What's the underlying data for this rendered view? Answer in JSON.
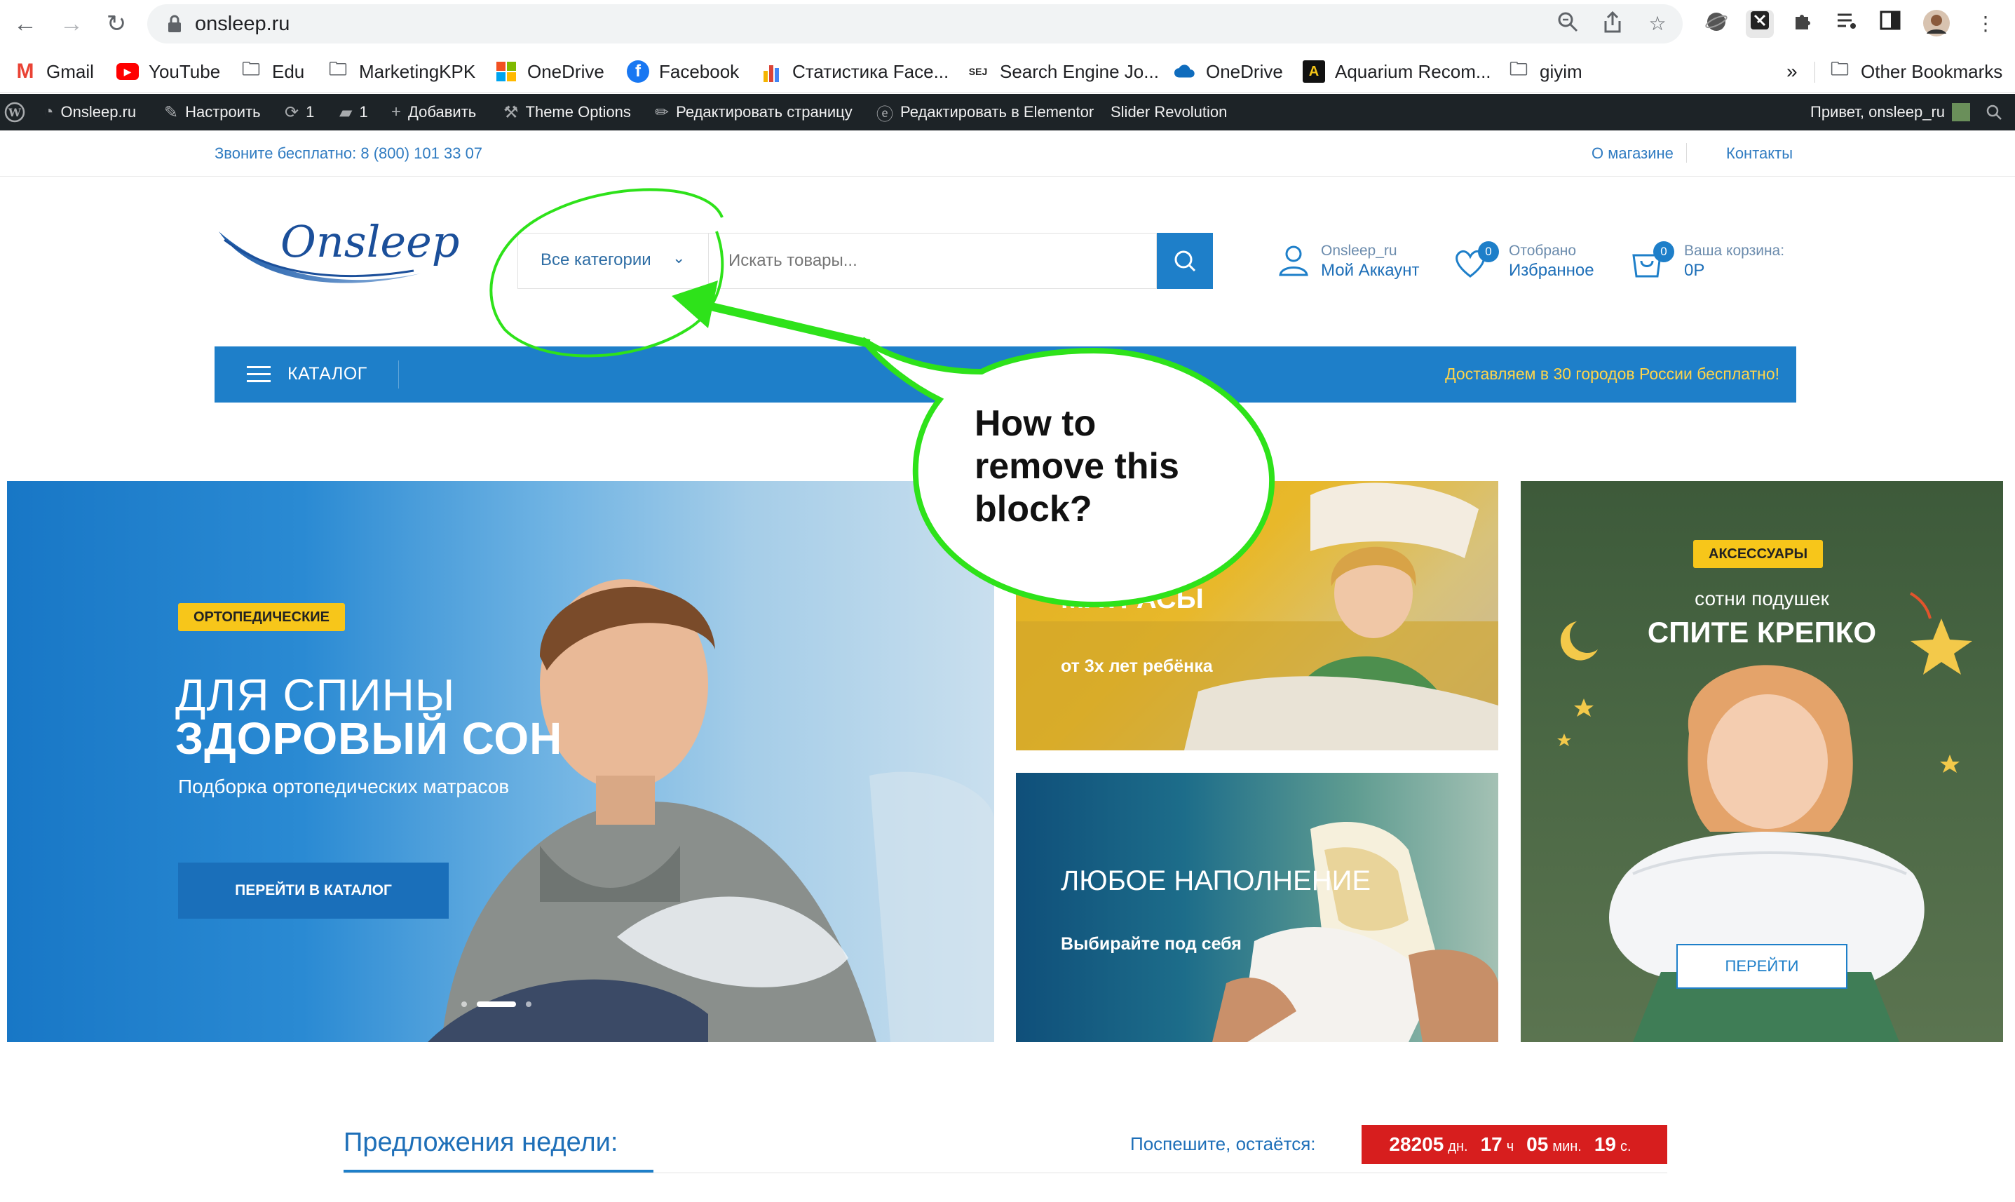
{
  "browser": {
    "url": "onsleep.ru",
    "bookmarks": [
      {
        "label": "Gmail",
        "icon": "gmail-icon"
      },
      {
        "label": "YouTube",
        "icon": "youtube-icon"
      },
      {
        "label": "Edu",
        "icon": "folder-icon"
      },
      {
        "label": "MarketingKPK",
        "icon": "folder-icon"
      },
      {
        "label": "OneDrive",
        "icon": "microsoft-icon"
      },
      {
        "label": "Facebook",
        "icon": "facebook-icon"
      },
      {
        "label": "Статистика Face...",
        "icon": "stats-icon"
      },
      {
        "label": "Search Engine Jo...",
        "icon": "sej-icon"
      },
      {
        "label": "OneDrive",
        "icon": "onedrive-cloud-icon"
      },
      {
        "label": "Aquarium Recom...",
        "icon": "aquarium-icon"
      },
      {
        "label": "giyim",
        "icon": "folder-icon"
      }
    ],
    "overflow_label": "»",
    "other_bookmarks": "Other Bookmarks"
  },
  "wpbar": {
    "site": "Onsleep.ru",
    "customize": "Настроить",
    "updates": "1",
    "comments": "1",
    "add": "Добавить",
    "theme_options": "Theme Options",
    "edit_page": "Редактировать страницу",
    "edit_elementor": "Редактировать в Elementor",
    "slider": "Slider Revolution",
    "greeting": "Привет, onsleep_ru"
  },
  "topinfo": {
    "phone": "Звоните бесплатно: 8 (800) 101 33 07",
    "about": "О магазине",
    "contacts": "Контакты"
  },
  "header": {
    "logo_text": "Onsleep",
    "category_select": "Все категории",
    "search_placeholder": "Искать товары...",
    "account_small": "Onsleep_ru",
    "account_big": "Мой Аккаунт",
    "wishlist_count": "0",
    "wishlist_small": "Отобрано",
    "wishlist_big": "Избранное",
    "cart_count": "0",
    "cart_small": "Ваша корзина:",
    "cart_big": "0Р"
  },
  "catbar": {
    "label": "КАТАЛОГ",
    "delivery": "Доставляем в 30 городов России бесплатно!"
  },
  "hero": {
    "tag": "ОРТОПЕДИЧЕСКИЕ",
    "title_line1": "ДЛЯ СПИНЫ",
    "title_line2": "ЗДОРОВЫЙ СОН",
    "subtitle": "Подборка ортопедических матрасов",
    "button": "ПЕРЕЙТИ В КАТАЛОГ",
    "slide_count": 3,
    "active_slide": 2
  },
  "mattress_banner": {
    "title": "МАТРАСЫ",
    "subtitle": "от 3х лет ребёнка"
  },
  "filling_banner": {
    "title": "ЛЮБОЕ НАПОЛНЕНИЕ",
    "subtitle": "Выбирайте под себя"
  },
  "accessories_banner": {
    "tag": "АКСЕССУАРЫ",
    "subtitle": "сотни подушек",
    "title": "СПИТЕ КРЕПКО",
    "button": "ПЕРЕЙТИ"
  },
  "annotation": {
    "line1": "How to",
    "line2": "remove this",
    "line3": "block?",
    "color": "#22dd11"
  },
  "offers": {
    "title": "Предложения недели:",
    "hurry": "Поспешите, остаётся:",
    "days": "28205",
    "days_unit": "дн.",
    "hours": "17",
    "hours_unit": "ч",
    "minutes": "05",
    "minutes_unit": "мин.",
    "seconds": "19",
    "seconds_unit": "с."
  },
  "colors": {
    "brand_blue": "#1e7fc9",
    "accent_yellow": "#f7c61a",
    "timer_red": "#d71e1e",
    "wp_bar": "#1d2327"
  }
}
